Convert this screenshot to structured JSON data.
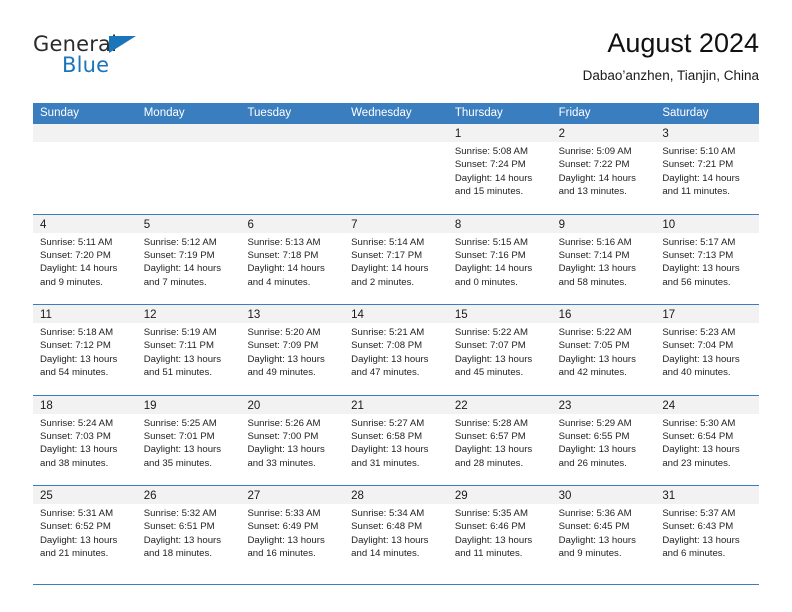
{
  "brand": {
    "name_part1": "General",
    "name_part2": "Blue",
    "triangle_color": "#1b75bb"
  },
  "header": {
    "title": "August 2024",
    "subtitle": "Dabao’anzhen, Tianjin, China"
  },
  "theme": {
    "header_blue": "#3a7ebf",
    "day_band_gray": "#f2f2f2",
    "text": "#1f1f1f"
  },
  "calendar": {
    "weekday_headers": [
      "Sunday",
      "Monday",
      "Tuesday",
      "Wednesday",
      "Thursday",
      "Friday",
      "Saturday"
    ],
    "weeks": [
      [
        {
          "day": "",
          "lines": []
        },
        {
          "day": "",
          "lines": []
        },
        {
          "day": "",
          "lines": []
        },
        {
          "day": "",
          "lines": []
        },
        {
          "day": "1",
          "lines": [
            "Sunrise: 5:08 AM",
            "Sunset: 7:24 PM",
            "Daylight: 14 hours",
            "and 15 minutes."
          ]
        },
        {
          "day": "2",
          "lines": [
            "Sunrise: 5:09 AM",
            "Sunset: 7:22 PM",
            "Daylight: 14 hours",
            "and 13 minutes."
          ]
        },
        {
          "day": "3",
          "lines": [
            "Sunrise: 5:10 AM",
            "Sunset: 7:21 PM",
            "Daylight: 14 hours",
            "and 11 minutes."
          ]
        }
      ],
      [
        {
          "day": "4",
          "lines": [
            "Sunrise: 5:11 AM",
            "Sunset: 7:20 PM",
            "Daylight: 14 hours",
            "and 9 minutes."
          ]
        },
        {
          "day": "5",
          "lines": [
            "Sunrise: 5:12 AM",
            "Sunset: 7:19 PM",
            "Daylight: 14 hours",
            "and 7 minutes."
          ]
        },
        {
          "day": "6",
          "lines": [
            "Sunrise: 5:13 AM",
            "Sunset: 7:18 PM",
            "Daylight: 14 hours",
            "and 4 minutes."
          ]
        },
        {
          "day": "7",
          "lines": [
            "Sunrise: 5:14 AM",
            "Sunset: 7:17 PM",
            "Daylight: 14 hours",
            "and 2 minutes."
          ]
        },
        {
          "day": "8",
          "lines": [
            "Sunrise: 5:15 AM",
            "Sunset: 7:16 PM",
            "Daylight: 14 hours",
            "and 0 minutes."
          ]
        },
        {
          "day": "9",
          "lines": [
            "Sunrise: 5:16 AM",
            "Sunset: 7:14 PM",
            "Daylight: 13 hours",
            "and 58 minutes."
          ]
        },
        {
          "day": "10",
          "lines": [
            "Sunrise: 5:17 AM",
            "Sunset: 7:13 PM",
            "Daylight: 13 hours",
            "and 56 minutes."
          ]
        }
      ],
      [
        {
          "day": "11",
          "lines": [
            "Sunrise: 5:18 AM",
            "Sunset: 7:12 PM",
            "Daylight: 13 hours",
            "and 54 minutes."
          ]
        },
        {
          "day": "12",
          "lines": [
            "Sunrise: 5:19 AM",
            "Sunset: 7:11 PM",
            "Daylight: 13 hours",
            "and 51 minutes."
          ]
        },
        {
          "day": "13",
          "lines": [
            "Sunrise: 5:20 AM",
            "Sunset: 7:09 PM",
            "Daylight: 13 hours",
            "and 49 minutes."
          ]
        },
        {
          "day": "14",
          "lines": [
            "Sunrise: 5:21 AM",
            "Sunset: 7:08 PM",
            "Daylight: 13 hours",
            "and 47 minutes."
          ]
        },
        {
          "day": "15",
          "lines": [
            "Sunrise: 5:22 AM",
            "Sunset: 7:07 PM",
            "Daylight: 13 hours",
            "and 45 minutes."
          ]
        },
        {
          "day": "16",
          "lines": [
            "Sunrise: 5:22 AM",
            "Sunset: 7:05 PM",
            "Daylight: 13 hours",
            "and 42 minutes."
          ]
        },
        {
          "day": "17",
          "lines": [
            "Sunrise: 5:23 AM",
            "Sunset: 7:04 PM",
            "Daylight: 13 hours",
            "and 40 minutes."
          ]
        }
      ],
      [
        {
          "day": "18",
          "lines": [
            "Sunrise: 5:24 AM",
            "Sunset: 7:03 PM",
            "Daylight: 13 hours",
            "and 38 minutes."
          ]
        },
        {
          "day": "19",
          "lines": [
            "Sunrise: 5:25 AM",
            "Sunset: 7:01 PM",
            "Daylight: 13 hours",
            "and 35 minutes."
          ]
        },
        {
          "day": "20",
          "lines": [
            "Sunrise: 5:26 AM",
            "Sunset: 7:00 PM",
            "Daylight: 13 hours",
            "and 33 minutes."
          ]
        },
        {
          "day": "21",
          "lines": [
            "Sunrise: 5:27 AM",
            "Sunset: 6:58 PM",
            "Daylight: 13 hours",
            "and 31 minutes."
          ]
        },
        {
          "day": "22",
          "lines": [
            "Sunrise: 5:28 AM",
            "Sunset: 6:57 PM",
            "Daylight: 13 hours",
            "and 28 minutes."
          ]
        },
        {
          "day": "23",
          "lines": [
            "Sunrise: 5:29 AM",
            "Sunset: 6:55 PM",
            "Daylight: 13 hours",
            "and 26 minutes."
          ]
        },
        {
          "day": "24",
          "lines": [
            "Sunrise: 5:30 AM",
            "Sunset: 6:54 PM",
            "Daylight: 13 hours",
            "and 23 minutes."
          ]
        }
      ],
      [
        {
          "day": "25",
          "lines": [
            "Sunrise: 5:31 AM",
            "Sunset: 6:52 PM",
            "Daylight: 13 hours",
            "and 21 minutes."
          ]
        },
        {
          "day": "26",
          "lines": [
            "Sunrise: 5:32 AM",
            "Sunset: 6:51 PM",
            "Daylight: 13 hours",
            "and 18 minutes."
          ]
        },
        {
          "day": "27",
          "lines": [
            "Sunrise: 5:33 AM",
            "Sunset: 6:49 PM",
            "Daylight: 13 hours",
            "and 16 minutes."
          ]
        },
        {
          "day": "28",
          "lines": [
            "Sunrise: 5:34 AM",
            "Sunset: 6:48 PM",
            "Daylight: 13 hours",
            "and 14 minutes."
          ]
        },
        {
          "day": "29",
          "lines": [
            "Sunrise: 5:35 AM",
            "Sunset: 6:46 PM",
            "Daylight: 13 hours",
            "and 11 minutes."
          ]
        },
        {
          "day": "30",
          "lines": [
            "Sunrise: 5:36 AM",
            "Sunset: 6:45 PM",
            "Daylight: 13 hours",
            "and 9 minutes."
          ]
        },
        {
          "day": "31",
          "lines": [
            "Sunrise: 5:37 AM",
            "Sunset: 6:43 PM",
            "Daylight: 13 hours",
            "and 6 minutes."
          ]
        }
      ]
    ]
  }
}
